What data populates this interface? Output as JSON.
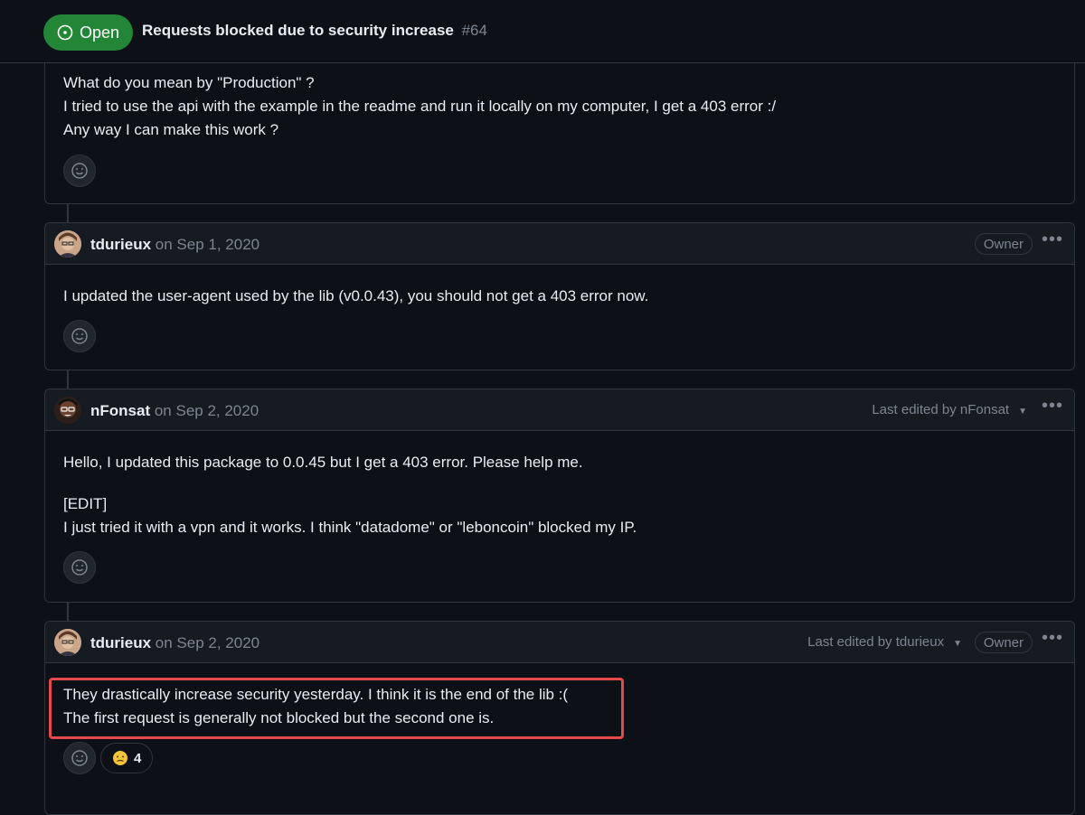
{
  "issue": {
    "state": "Open",
    "title": "Requests blocked due to security increase",
    "number": "#64"
  },
  "comments": [
    {
      "lines": [
        "What do you mean by \"Production\" ?",
        "I tried to use the api with the example in the readme and run it locally on my computer, I get a 403 error :/",
        "Any way I can make this work ?"
      ]
    },
    {
      "author": "tdurieux",
      "date": "on Sep 1, 2020",
      "badge": "Owner",
      "lines": [
        "I updated the user-agent used by the lib (v0.0.43), you should not get a 403 error now."
      ]
    },
    {
      "author": "nFonsat",
      "date": "on Sep 2, 2020",
      "edited": "Last edited by nFonsat",
      "lines": [
        "Hello, I updated this package to 0.0.45 but I get a 403 error. Please help me.",
        "[EDIT]",
        "I just tried it with a vpn and it works. I think \"datadome\" or \"leboncoin\" blocked my IP."
      ]
    },
    {
      "author": "tdurieux",
      "date": "on Sep 2, 2020",
      "edited": "Last edited by tdurieux",
      "badge": "Owner",
      "lines": [
        "They drastically increase security yesterday. I think it is the end of the lib :(",
        "The first request is generally not blocked but the second one is."
      ],
      "reaction": {
        "icon": "confused-face-icon",
        "count": "4"
      }
    }
  ],
  "colors": {
    "open_green": "#238636",
    "highlight_red": "#e5484d",
    "background": "#0d1117"
  }
}
